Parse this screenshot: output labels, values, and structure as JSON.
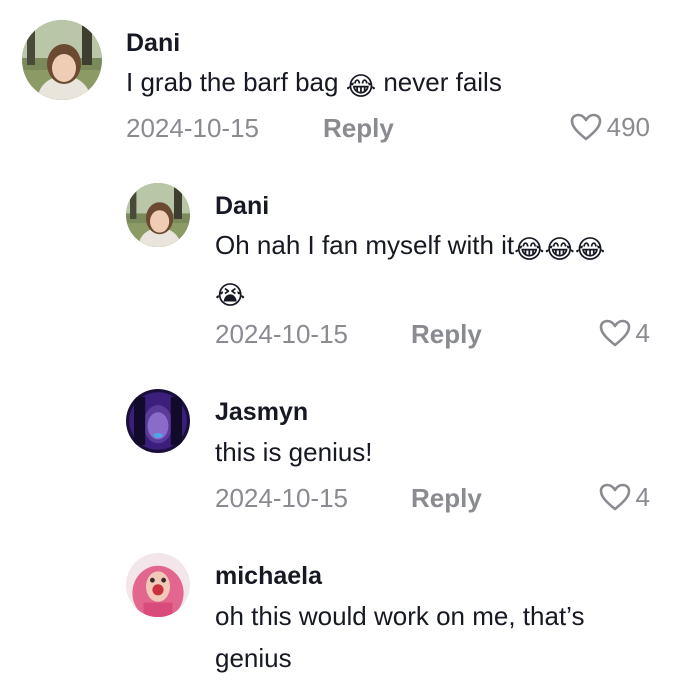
{
  "comments": [
    {
      "username": "Dani",
      "text_before": "I grab the barf bag ",
      "emoji": "😂",
      "text_after": " never fails",
      "date": "2024-10-15",
      "reply_label": "Reply",
      "likes": "490"
    },
    {
      "username": "Dani",
      "text_line1": "Oh nah I fan myself with it",
      "emojis_line1": "😂😂😂",
      "emoji_line2": "😭",
      "date": "2024-10-15",
      "reply_label": "Reply",
      "likes": "4"
    },
    {
      "username": "Jasmyn",
      "text": "this is genius!",
      "date": "2024-10-15",
      "reply_label": "Reply",
      "likes": "4"
    },
    {
      "username": "michaela",
      "text": "oh this would work on me, that’s genius"
    }
  ],
  "icons": {
    "like": "heart-outline-icon"
  },
  "colors": {
    "text": "#161823",
    "muted": "#8a8b91"
  }
}
